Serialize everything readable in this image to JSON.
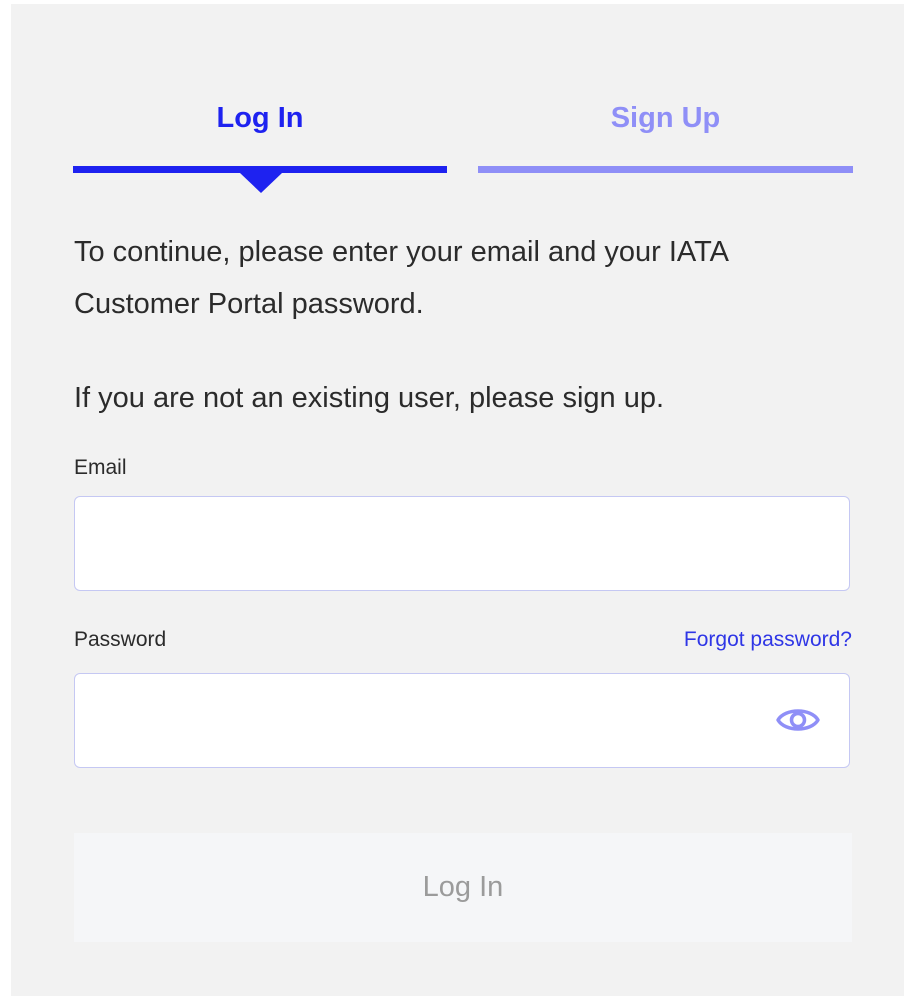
{
  "tabs": {
    "login_label": "Log In",
    "signup_label": "Sign Up"
  },
  "intro": {
    "text": "To continue, please enter your email and your IATA Customer Portal password.",
    "signup_hint": "If you are not an existing user, please sign up."
  },
  "form": {
    "email_label": "Email",
    "email_value": "",
    "password_label": "Password",
    "password_value": "",
    "forgot_password_label": "Forgot password?",
    "submit_label": "Log In",
    "password_toggle_icon": "eye-icon"
  },
  "colors": {
    "accent": "#1e22f0",
    "accent_light": "#8f8ff7",
    "link": "#2f36e6",
    "panel_bg": "#f2f2f2",
    "button_disabled_bg": "#f5f6f8",
    "button_disabled_text": "#9b9b9b"
  }
}
